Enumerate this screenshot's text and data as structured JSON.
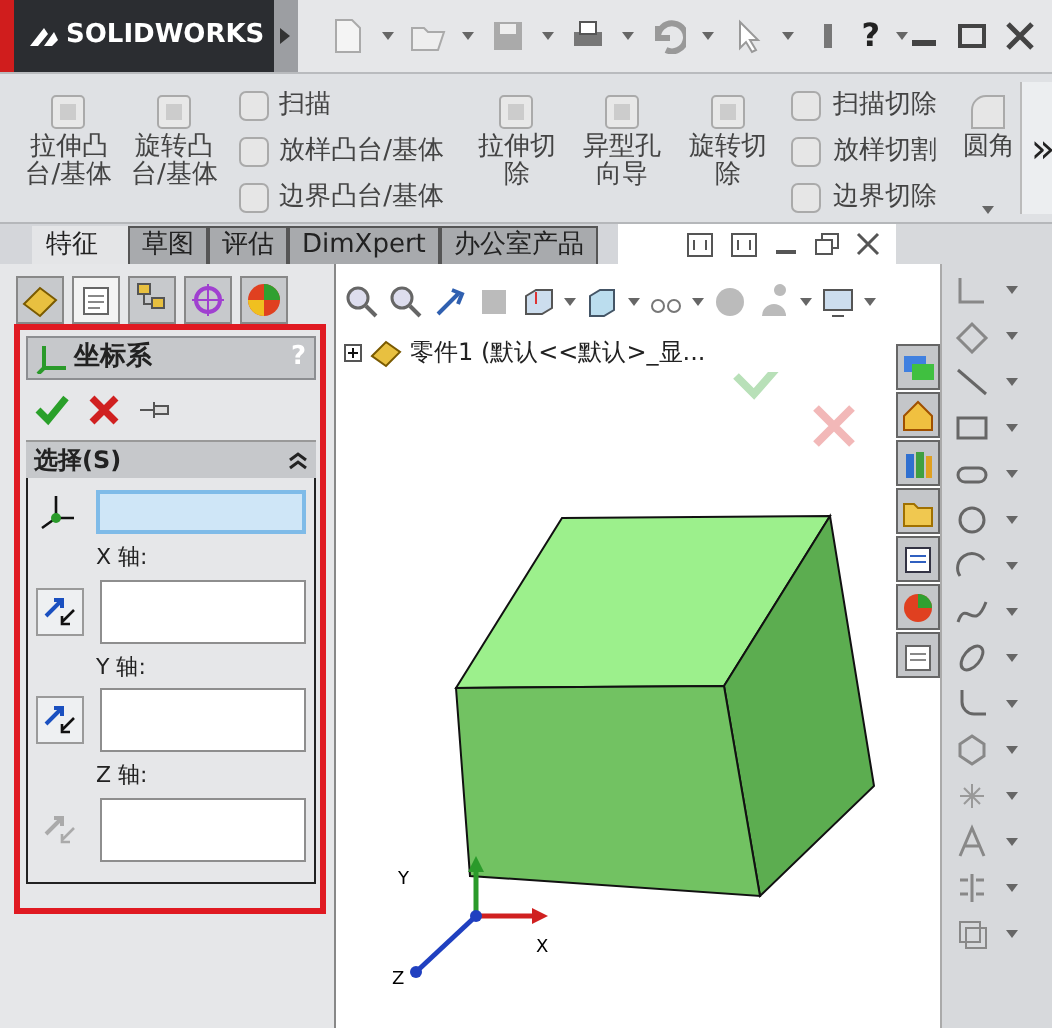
{
  "title_bar": {
    "logo": "SOLIDWORKS",
    "help": "?"
  },
  "ribbon": {
    "groups": [
      {
        "large": [
          {
            "label": "拉伸凸台/基体"
          },
          {
            "label": "旋转凸台/基体"
          }
        ],
        "small": [
          {
            "label": "扫描"
          },
          {
            "label": "放样凸台/基体"
          },
          {
            "label": "边界凸台/基体"
          }
        ]
      },
      {
        "large": [
          {
            "label": "拉伸切除"
          },
          {
            "label": "异型孔向导"
          },
          {
            "label": "旋转切除"
          }
        ],
        "small": [
          {
            "label": "扫描切除"
          },
          {
            "label": "放样切割"
          },
          {
            "label": "边界切除"
          }
        ]
      }
    ],
    "fillet": {
      "label": "圆角"
    },
    "more": "»"
  },
  "command_tabs": [
    {
      "label": "特征",
      "selected": true
    },
    {
      "label": "草图",
      "selected": false
    },
    {
      "label": "评估",
      "selected": false
    },
    {
      "label": "DimXpert",
      "selected": false
    },
    {
      "label": "办公室产品",
      "selected": false
    }
  ],
  "panel_tabs": [
    {
      "selected": false
    },
    {
      "selected": true
    },
    {
      "selected": false
    },
    {
      "selected": false
    },
    {
      "selected": false
    }
  ],
  "property_manager": {
    "title": "坐标系",
    "help": "?",
    "section": {
      "title": "选择(S)",
      "expanded": true
    },
    "origin_field": {
      "active": true
    },
    "axes": [
      {
        "label": "X 轴:",
        "enabled": true
      },
      {
        "label": "Y 轴:",
        "enabled": true
      },
      {
        "label": "Z 轴:",
        "enabled": false
      }
    ]
  },
  "viewport": {
    "tree_item": "零件1 (默认<<默认>_显...",
    "triad": [
      "Y",
      "X",
      "Z"
    ]
  }
}
